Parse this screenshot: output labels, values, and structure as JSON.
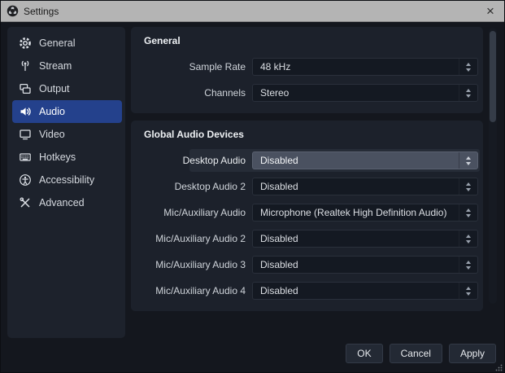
{
  "window": {
    "title": "Settings",
    "close_glyph": "×"
  },
  "sidebar": {
    "selected": "Audio",
    "items": [
      {
        "icon": "gear-icon",
        "label": "General"
      },
      {
        "icon": "stream-icon",
        "label": "Stream"
      },
      {
        "icon": "output-icon",
        "label": "Output"
      },
      {
        "icon": "audio-icon",
        "label": "Audio"
      },
      {
        "icon": "video-icon",
        "label": "Video"
      },
      {
        "icon": "hotkeys-icon",
        "label": "Hotkeys"
      },
      {
        "icon": "accessibility-icon",
        "label": "Accessibility"
      },
      {
        "icon": "advanced-icon",
        "label": "Advanced"
      }
    ]
  },
  "sections": [
    {
      "title": "General",
      "rows": [
        {
          "label": "Sample Rate",
          "value": "48 kHz"
        },
        {
          "label": "Channels",
          "value": "Stereo"
        }
      ]
    },
    {
      "title": "Global Audio Devices",
      "rows": [
        {
          "label": "Desktop Audio",
          "value": "Disabled",
          "focused": true
        },
        {
          "label": "Desktop Audio 2",
          "value": "Disabled"
        },
        {
          "label": "Mic/Auxiliary Audio",
          "value": "Microphone (Realtek High Definition Audio)"
        },
        {
          "label": "Mic/Auxiliary Audio 2",
          "value": "Disabled"
        },
        {
          "label": "Mic/Auxiliary Audio 3",
          "value": "Disabled"
        },
        {
          "label": "Mic/Auxiliary Audio 4",
          "value": "Disabled"
        }
      ]
    }
  ],
  "footer": {
    "buttons": [
      "OK",
      "Cancel",
      "Apply"
    ]
  },
  "colors": {
    "titlebar": "#b4b4b4",
    "window_bg": "#14171e",
    "panel_bg": "#1c212b",
    "accent_selected": "#24418c",
    "combo_bg": "#141922",
    "combo_focused_bg": "#4a5160"
  }
}
